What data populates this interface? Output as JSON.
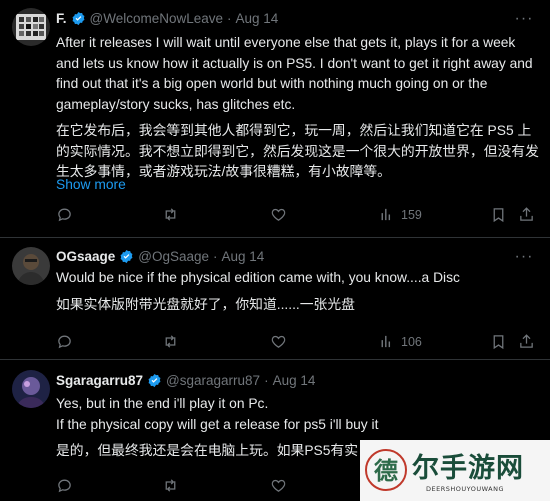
{
  "tweets": [
    {
      "display_name": "F.",
      "handle": "@WelcomeNowLeave",
      "separator": "·",
      "date": "Aug 14",
      "text_en": "After it releases I will wait until everyone else that gets it, plays it for a week and lets us know how it actually is on PS5. I don't want to get it right away and find out that it's a big open world but with nothing much going on or the gameplay/story sucks, has glitches etc.",
      "text_zh": "在它发布后，我会等到其他人都得到它，玩一周，然后让我们知道它在 PS5 上的实际情况。我不想立即得到它，然后发现这是一个很大的开放世界，但没有发生太多事情，或者游戏玩法/故事很糟糕，有小故障等。",
      "show_more": "Show more",
      "views": "159"
    },
    {
      "display_name": "OGsaage",
      "handle": "@OgSaage",
      "separator": "·",
      "date": "Aug 14",
      "text_en": "Would be nice if the physical edition came with, you know....a Disc",
      "text_zh": "如果实体版附带光盘就好了，你知道......一张光盘",
      "views": "106"
    },
    {
      "display_name": "Sgaragarru87",
      "handle": "@sgaragarru87",
      "separator": "·",
      "date": "Aug 14",
      "text_en_1": "Yes, but in the end i'll play it on Pc.",
      "text_en_2": "If the physical copy will get a release for ps5 i'll buy it",
      "text_zh": "是的，但最终我还是会在电脑上玩。如果PS5有实"
    }
  ],
  "icons": {
    "verified": "verified-badge-icon",
    "more": "more-dots-icon",
    "reply": "reply-icon",
    "retweet": "retweet-icon",
    "like": "heart-icon",
    "views": "views-chart-icon",
    "bookmark": "bookmark-icon",
    "share": "share-icon"
  },
  "watermark": {
    "main": "尔手游网",
    "sub": "DEERSHOUYOUWANG",
    "logo_char": "德"
  },
  "colors": {
    "background": "#000000",
    "text": "#e7e9ea",
    "muted": "#71767b",
    "link": "#1d9bf0",
    "verified": "#1d9bf0"
  }
}
